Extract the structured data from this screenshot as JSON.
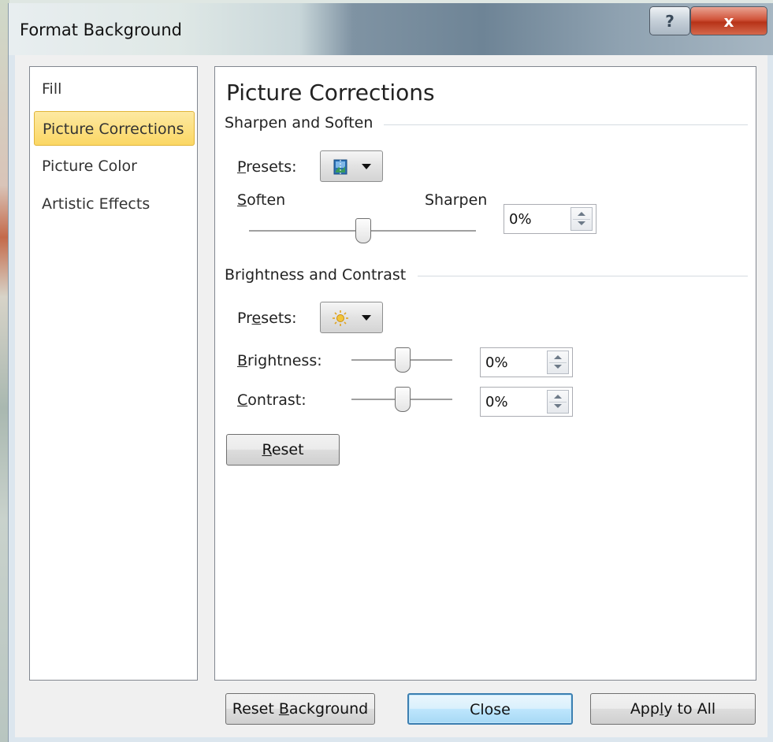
{
  "window": {
    "title": "Format Background",
    "help_label": "?",
    "close_label": "x"
  },
  "nav": {
    "items": [
      {
        "label": "Fill"
      },
      {
        "label": "Picture Corrections"
      },
      {
        "label": "Picture Color"
      },
      {
        "label": "Artistic Effects"
      }
    ],
    "selected": "Picture Corrections"
  },
  "content": {
    "heading": "Picture Corrections",
    "sharpen_section": {
      "title": "Sharpen and Soften",
      "presets_label_key": "P",
      "presets_label_rest": "resets:",
      "presets_icon": "sharpen-preset-icon",
      "soften_label_key": "S",
      "soften_label_rest": "often",
      "sharpen_label": "Sharpen",
      "value": "0%"
    },
    "brightness_section": {
      "title": "Brightness and Contrast",
      "presets_label_pre": "Pr",
      "presets_label_key": "e",
      "presets_label_post": "sets:",
      "presets_icon": "sun-icon",
      "brightness_label_key": "B",
      "brightness_label_rest": "rightness:",
      "brightness_value": "0%",
      "contrast_label_key": "C",
      "contrast_label_rest": "ontrast:",
      "contrast_value": "0%",
      "reset_label_key": "R",
      "reset_label_rest": "eset"
    }
  },
  "footer": {
    "reset_background_pre": "Reset ",
    "reset_background_key": "B",
    "reset_background_post": "ackground",
    "close_label": "Close",
    "apply_pre": "App",
    "apply_key": "l",
    "apply_post": "y to All"
  },
  "colors": {
    "selection_fill": "#fbd764",
    "default_button_border": "#3c7fb1",
    "close_button_red": "#c7432a"
  }
}
